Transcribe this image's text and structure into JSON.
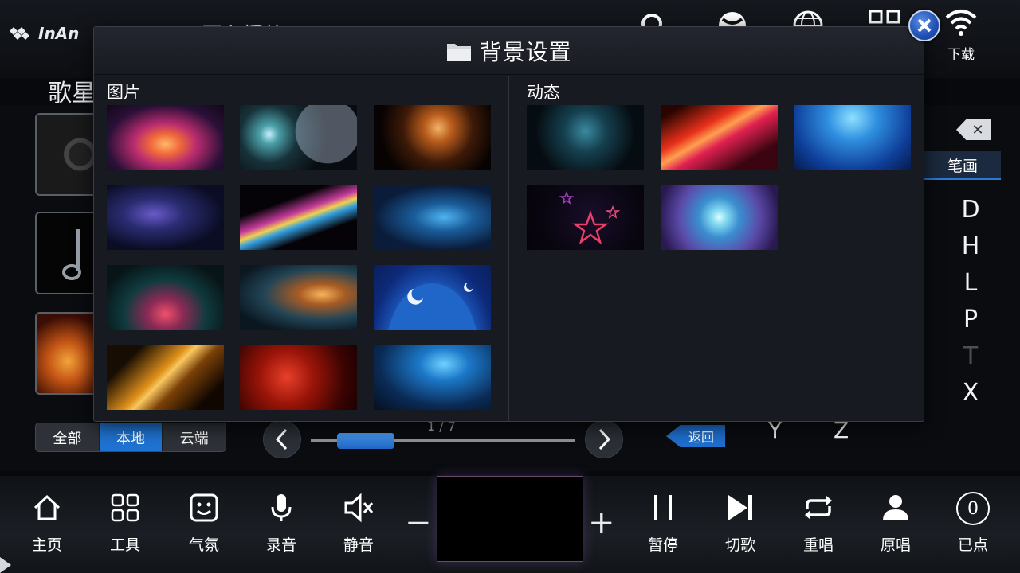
{
  "app": {
    "brand": "InAn",
    "now_playing": "... 正在播放 ..."
  },
  "topbar": {
    "download_label": "下载"
  },
  "background": {
    "category_label": "歌星",
    "source_tabs": [
      {
        "label": "全部",
        "active": false
      },
      {
        "label": "本地",
        "active": true
      },
      {
        "label": "云端",
        "active": false
      }
    ],
    "page_indicator": "1 / 7",
    "back_label": "返回",
    "stroke_tab": "笔画",
    "alphabet": [
      "D",
      "H",
      "L",
      "P",
      "T",
      "X"
    ],
    "alphabet_dim": [
      "T"
    ],
    "letter_y": "Y",
    "letter_z": "Z"
  },
  "bottom_bar": {
    "left_controls": [
      {
        "label": "主页",
        "icon": "home-icon"
      },
      {
        "label": "工具",
        "icon": "grid-icon"
      },
      {
        "label": "气氛",
        "icon": "smiley-icon"
      },
      {
        "label": "录音",
        "icon": "microphone-icon"
      },
      {
        "label": "静音",
        "icon": "mute-icon"
      }
    ],
    "volume_minus": "−",
    "volume_plus": "+",
    "right_controls": [
      {
        "label": "暂停",
        "icon": "pause-icon"
      },
      {
        "label": "切歌",
        "icon": "skip-icon"
      },
      {
        "label": "重唱",
        "icon": "repeat-icon"
      },
      {
        "label": "原唱",
        "icon": "person-icon"
      },
      {
        "label": "已点",
        "icon": "count-badge-icon"
      }
    ],
    "queued_count": "0"
  },
  "dialog": {
    "title": "背景设置",
    "icon": "folder-icon",
    "sections": [
      {
        "label": "图片",
        "count": 12
      },
      {
        "label": "动态",
        "count": 5
      }
    ]
  }
}
